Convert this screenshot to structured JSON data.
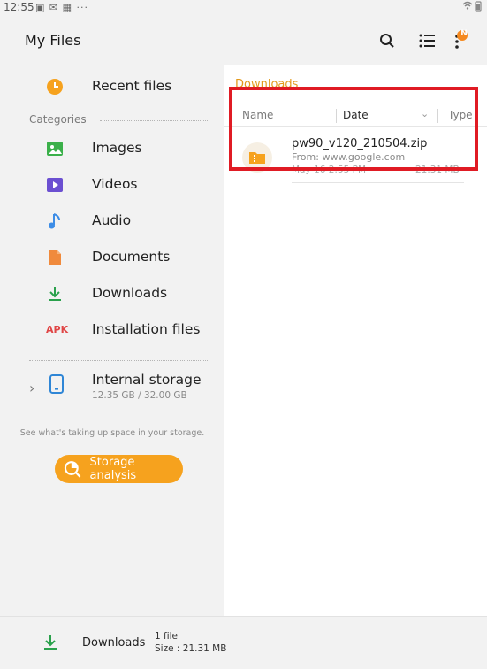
{
  "status_bar": {
    "time": "12:55",
    "left_icons": "▣ ✉ ▦ ···",
    "right_icons": "📶 🔋"
  },
  "app_bar": {
    "title": "My Files",
    "search_icon": "search-icon",
    "list_icon": "list-icon",
    "more_icon": "more-icon",
    "badge": "N"
  },
  "sidebar": {
    "recent": "Recent files",
    "categories_label": "Categories",
    "items": [
      {
        "label": "Images",
        "icon": "image-icon",
        "color": "#3bb04a"
      },
      {
        "label": "Videos",
        "icon": "video-icon",
        "color": "#6b4fd1"
      },
      {
        "label": "Audio",
        "icon": "audio-icon",
        "color": "#3d8de6"
      },
      {
        "label": "Documents",
        "icon": "document-icon",
        "color": "#f08a3c"
      },
      {
        "label": "Downloads",
        "icon": "download-icon",
        "color": "#2aa14c"
      },
      {
        "label": "Installation files",
        "icon": "apk-icon",
        "color": "#e04646",
        "badge": "APK"
      }
    ],
    "storage": {
      "label": "Internal storage",
      "size": "12.35 GB / 32.00 GB"
    },
    "hint": "See what's taking up space in your storage.",
    "storage_button": "Storage analysis"
  },
  "main": {
    "breadcrumb": "Downloads",
    "columns": {
      "name": "Name",
      "date": "Date",
      "type": "Type"
    },
    "files": [
      {
        "name": "pw90_v120_210504.zip",
        "source": "From: www.google.com",
        "date": "May 16 2:55 PM",
        "size": "21.31 MB"
      }
    ]
  },
  "bottom_bar": {
    "label": "Downloads",
    "files": "1 file",
    "size": "Size : 21.31 MB"
  },
  "colors": {
    "accent": "#f6a21e",
    "highlight": "#e01b24"
  }
}
